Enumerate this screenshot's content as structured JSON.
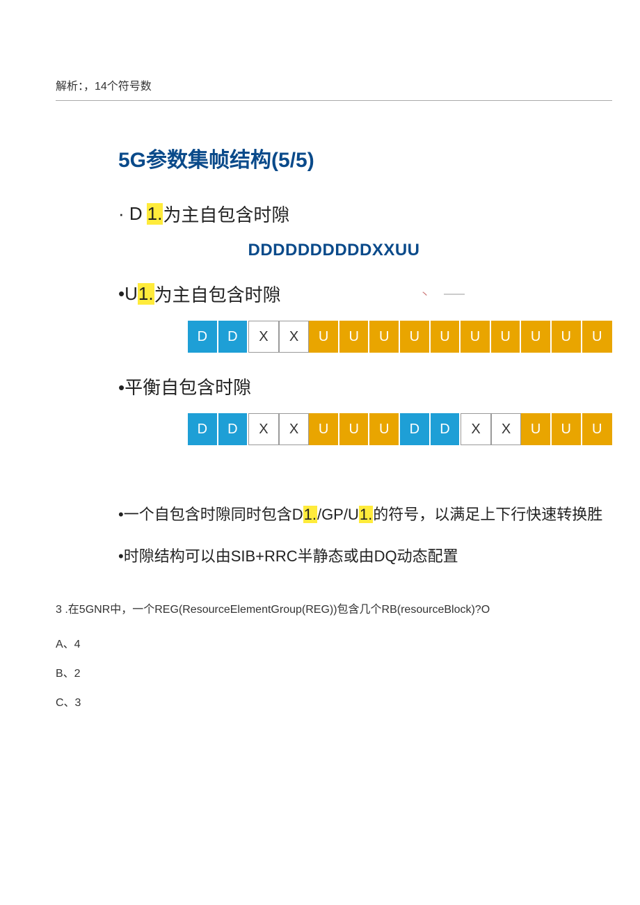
{
  "analysis": "解析：，14个符号数",
  "sectionTitle": "5G参数集帧结构(5/5)",
  "bullet1": {
    "prefix": "· D",
    "hl": "1.",
    "suffix": "为主自包含时隙"
  },
  "pattern1": "DDDDDDDDDDXXUU",
  "bullet2": {
    "prefix": "•U",
    "hl": "1.",
    "suffix": "为主自包含时隙"
  },
  "row2": [
    "D",
    "D",
    "X",
    "X",
    "U",
    "U",
    "U",
    "U",
    "U",
    "U",
    "U",
    "U",
    "U",
    "U"
  ],
  "bullet3": "•平衡自包含时隙",
  "row3": [
    "D",
    "D",
    "X",
    "X",
    "U",
    "U",
    "U",
    "D",
    "D",
    "X",
    "X",
    "U",
    "U",
    "U"
  ],
  "body1": {
    "p1": "•一个自包含时隙同时包含D",
    "h1": "1.",
    "p2": "/GP/U",
    "h2": "1.",
    "p3": "的符号，以满足上下行快速转换胜"
  },
  "body2": "•时隙结构可以由SIB+RRC半静态或由DQ动态配置",
  "question": "3 .在5GNR中，一个REG(ResourceElementGroup(REG))包含几个RB(resourceBlock)?O",
  "options": {
    "a": "A、4",
    "b": "B、2",
    "c": "C、3"
  }
}
